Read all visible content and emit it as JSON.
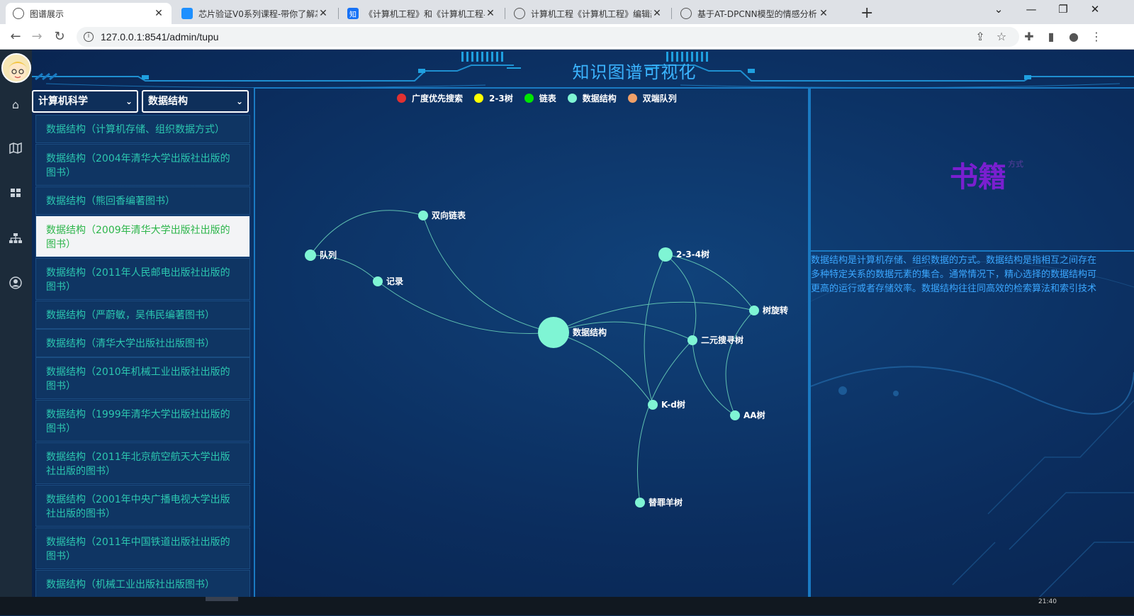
{
  "browser": {
    "tabs": [
      {
        "title": "图谱展示",
        "active": true,
        "icon": "globe-icon"
      },
      {
        "title": "芯片验证V0系列课程-带你了解芯",
        "active": false,
        "icon": "bilibili-icon"
      },
      {
        "title": "《计算机工程》和《计算机工程与",
        "active": false,
        "icon": "zhihu-icon",
        "icon_text": "知"
      },
      {
        "title": "计算机工程《计算机工程》编辑部",
        "active": false,
        "icon": "globe-icon"
      },
      {
        "title": "基于AT-DPCNN模型的情感分析",
        "active": false,
        "icon": "globe-icon"
      }
    ],
    "url": "127.0.0.1:8541/admin/tupu"
  },
  "header": {
    "title": "知识图谱可视化"
  },
  "filters": {
    "subject": "计算机科学",
    "course": "数据结构"
  },
  "books": [
    "数据结构（计算机存储、组织数据方式）",
    "数据结构（2004年清华大学出版社出版的图书）",
    "数据结构（熊回香编著图书）",
    "数据结构（2009年清华大学出版社出版的图书）",
    "数据结构（2011年人民邮电出版社出版的图书）",
    "数据结构（严蔚敏，吴伟民编著图书）",
    "数据结构（清华大学出版社出版图书）",
    "数据结构（2010年机械工业出版社出版的图书）",
    "数据结构（1999年清华大学出版社出版的图书）",
    "数据结构（2011年北京航空航天大学出版社出版的图书）",
    "数据结构（2001年中央广播电视大学出版社出版的图书）",
    "数据结构（2011年中国铁道出版社出版的图书）",
    "数据结构（机械工业出版社出版图书）"
  ],
  "active_book_index": 3,
  "graph": {
    "legend": [
      {
        "name": "广度优先搜索",
        "color": "#e03131"
      },
      {
        "name": "2-3树",
        "color": "#ffff00"
      },
      {
        "name": "链表",
        "color": "#00e600"
      },
      {
        "name": "数据结构",
        "color": "#7ff5d4"
      },
      {
        "name": "双端队列",
        "color": "#f0a068"
      }
    ],
    "nodes": [
      {
        "id": "root",
        "label": "数据结构"
      },
      {
        "id": "queue",
        "label": "队列"
      },
      {
        "id": "dll",
        "label": "双向链表"
      },
      {
        "id": "record",
        "label": "记录"
      },
      {
        "id": "t234",
        "label": "2-3-4树"
      },
      {
        "id": "rot",
        "label": "树旋转"
      },
      {
        "id": "bst",
        "label": "二元搜寻树"
      },
      {
        "id": "kd",
        "label": "K-d树"
      },
      {
        "id": "aa",
        "label": "AA树"
      },
      {
        "id": "scape",
        "label": "替罪羊树"
      }
    ],
    "edges": [
      [
        "queue",
        "dll"
      ],
      [
        "queue",
        "record"
      ],
      [
        "root",
        "dll"
      ],
      [
        "root",
        "record"
      ],
      [
        "root",
        "rot"
      ],
      [
        "root",
        "bst"
      ],
      [
        "root",
        "kd"
      ],
      [
        "t234",
        "bst"
      ],
      [
        "t234",
        "rot"
      ],
      [
        "t234",
        "kd"
      ],
      [
        "aa",
        "rot"
      ],
      [
        "aa",
        "bst"
      ],
      [
        "scape",
        "bst"
      ]
    ]
  },
  "detail": {
    "title": "书籍",
    "subtitle": "方式",
    "lines": [
      "数据结构是计算机存储、组织数据的方式。数据结构是指相互之间存在",
      "多种特定关系的数据元素的集合。通常情况下，精心选择的数据结构可",
      "更高的运行或者存储效率。数据结构往往同高效的检索算法和索引技术"
    ]
  },
  "taskbar": {
    "clock": "21:40"
  }
}
